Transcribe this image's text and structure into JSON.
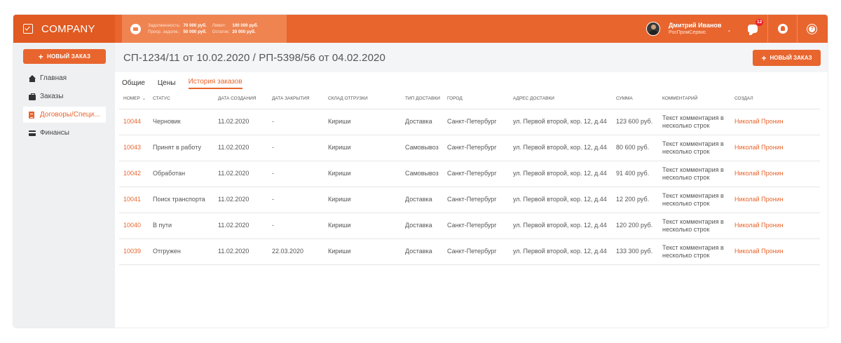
{
  "app": {
    "logo_text": "COMPANY"
  },
  "debt": {
    "debt_label": "Задолженность:",
    "debt_value": "70 000 руб.",
    "limit_label": "Лимит:",
    "limit_value": "100 000 руб.",
    "overdue_label": "Проср. задолж.:",
    "overdue_value": "50 000 руб.",
    "remain_label": "Остаток:",
    "remain_value": "20 000 руб."
  },
  "user": {
    "name": "Дмитрий Иванов",
    "company": "РосПромСервис",
    "caret": "⌄"
  },
  "notifications": {
    "chat_count": "12"
  },
  "help_glyph": "?",
  "sidebar": {
    "new_order_label": "НОВЫЙ ЗАКАЗ",
    "plus": "+",
    "items": [
      {
        "label": "Главная"
      },
      {
        "label": "Заказы"
      },
      {
        "label": "Договоры/Специ..."
      },
      {
        "label": "Финансы"
      }
    ]
  },
  "main": {
    "title": "СП-1234/11 от 10.02.2020 / РП-5398/56 от 04.02.2020",
    "new_order_label": "НОВЫЙ ЗАКАЗ",
    "tabs": [
      {
        "label": "Общие"
      },
      {
        "label": "Цены"
      },
      {
        "label": "История заказов"
      }
    ]
  },
  "table": {
    "sort_caret": "⌄",
    "columns": [
      "Номер",
      "Статус",
      "Дата создания",
      "Дата закрытия",
      "Склад отгрузки",
      "Тип доставки",
      "Город",
      "Адрес доставки",
      "Сумма",
      "Комментарий",
      "Создал"
    ],
    "rows": [
      {
        "num": "10044",
        "status": "Черновик",
        "created": "11.02.2020",
        "closed": "-",
        "warehouse": "Кириши",
        "delivery": "Доставка",
        "city": "Санкт-Петербург",
        "address": "ул. Первой второй, кор. 12, д.44",
        "sum": "123 600 руб.",
        "comment": "Текст комментария в несколько строк",
        "creator": "Николай Пронин"
      },
      {
        "num": "10043",
        "status": "Принят в работу",
        "created": "11.02.2020",
        "closed": "-",
        "warehouse": "Кириши",
        "delivery": "Самовывоз",
        "city": "Санкт-Петербург",
        "address": "ул. Первой второй, кор. 12, д.44",
        "sum": "80 600 руб.",
        "comment": "Текст комментария в несколько строк",
        "creator": "Николай Пронин"
      },
      {
        "num": "10042",
        "status": "Обработан",
        "created": "11.02.2020",
        "closed": "-",
        "warehouse": "Кириши",
        "delivery": "Самовывоз",
        "city": "Санкт-Петербург",
        "address": "ул. Первой второй, кор. 12, д.44",
        "sum": "91 400 руб.",
        "comment": "Текст комментария в несколько строк",
        "creator": "Николай Пронин"
      },
      {
        "num": "10041",
        "status": "Поиск транспорта",
        "created": "11.02.2020",
        "closed": "-",
        "warehouse": "Кириши",
        "delivery": "Доставка",
        "city": "Санкт-Петербург",
        "address": "ул. Первой второй, кор. 12, д.44",
        "sum": "12 200 руб.",
        "comment": "Текст комментария в несколько строк",
        "creator": "Николай Пронин"
      },
      {
        "num": "10040",
        "status": "В пути",
        "created": "11.02.2020",
        "closed": "-",
        "warehouse": "Кириши",
        "delivery": "Доставка",
        "city": "Санкт-Петербург",
        "address": "ул. Первой второй, кор. 12, д.44",
        "sum": "120 200 руб.",
        "comment": "Текст комментария в несколько строк",
        "creator": "Николай Пронин"
      },
      {
        "num": "10039",
        "status": "Отгружен",
        "created": "11.02.2020",
        "closed": "22.03.2020",
        "warehouse": "Кириши",
        "delivery": "Доставка",
        "city": "Санкт-Петербург",
        "address": "ул. Первой второй, кор. 12, д.44",
        "sum": "133 300 руб.",
        "comment": "Текст комментария в несколько строк",
        "creator": "Николай Пронин"
      }
    ]
  },
  "colors": {
    "accent": "#e8652e",
    "accent_dark": "#e05a21",
    "sidebar_bg": "#eef0f2"
  }
}
